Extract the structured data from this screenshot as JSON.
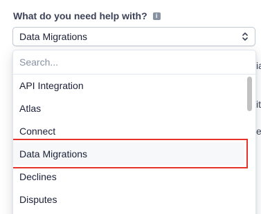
{
  "form": {
    "label": "What do you need help with?",
    "info_icon": "i",
    "selected_value": "Data Migrations"
  },
  "background_fragments": [
    "ia",
    "it",
    "es"
  ],
  "dropdown": {
    "search_placeholder": "Search...",
    "options": [
      {
        "label": "API Integration"
      },
      {
        "label": "Atlas"
      },
      {
        "label": "Connect"
      },
      {
        "label": "Data Migrations",
        "highlighted": true
      },
      {
        "label": "Declines"
      },
      {
        "label": "Disputes"
      }
    ]
  },
  "colors": {
    "highlight_border": "#e5332a",
    "active_background": "#f6f8fa",
    "text": "#1a1f36",
    "placeholder": "#8792a2"
  },
  "icons": [
    "info-icon",
    "chevrons-up-down-icon"
  ]
}
